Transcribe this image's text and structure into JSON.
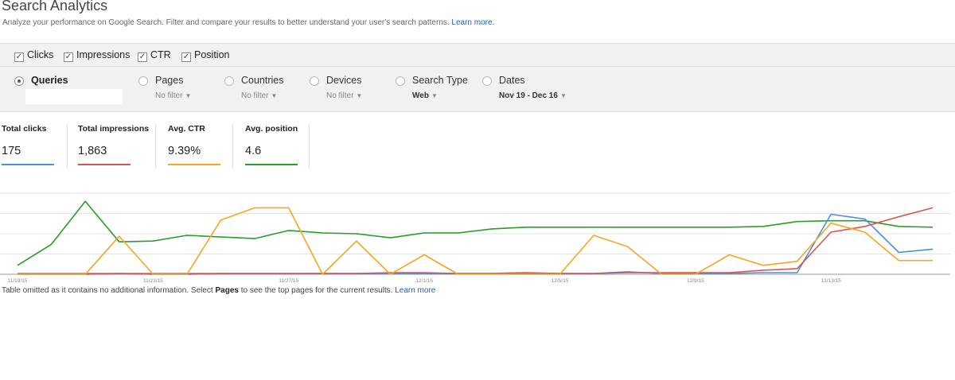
{
  "header": {
    "title": "Search Analytics",
    "subtitle": "Analyze your performance on Google Search. Filter and compare your results to better understand your user's search patterns.",
    "learn_more": "Learn more."
  },
  "metrics": {
    "clicks": {
      "label": "Clicks",
      "checked": true
    },
    "impressions": {
      "label": "Impressions",
      "checked": true
    },
    "ctr": {
      "label": "CTR",
      "checked": true
    },
    "position": {
      "label": "Position",
      "checked": true
    }
  },
  "group_by": {
    "queries": {
      "label": "Queries",
      "selected": true,
      "input_value": ""
    },
    "pages": {
      "label": "Pages",
      "filter": "No filter"
    },
    "countries": {
      "label": "Countries",
      "filter": "No filter"
    },
    "devices": {
      "label": "Devices",
      "filter": "No filter"
    },
    "search_type": {
      "label": "Search Type",
      "filter": "Web"
    },
    "dates": {
      "label": "Dates",
      "filter": "Nov 19 - Dec 16"
    }
  },
  "totals": {
    "clicks": {
      "label": "Total clicks",
      "value": "175",
      "color": "#4a90d9"
    },
    "impressions": {
      "label": "Total impressions",
      "value": "1,863",
      "color": "#d9534f"
    },
    "ctr": {
      "label": "Avg. CTR",
      "value": "9.39%",
      "color": "#f5a623"
    },
    "position": {
      "label": "Avg. position",
      "value": "4.6",
      "color": "#2a9d2a"
    }
  },
  "chart_data": {
    "type": "line",
    "x": [
      "11/19/15",
      "11/20/15",
      "11/21/15",
      "11/22/15",
      "11/23/15",
      "11/24/15",
      "11/25/15",
      "11/26/15",
      "11/27/15",
      "11/28/15",
      "11/29/15",
      "11/30/15",
      "12/1/15",
      "12/2/15",
      "12/3/15",
      "12/4/15",
      "12/5/15",
      "12/6/15",
      "12/7/15",
      "12/8/15",
      "12/9/15",
      "12/10/15",
      "12/11/15",
      "12/12/15",
      "12/13/15",
      "12/14/15",
      "12/15/15",
      "12/16/15"
    ],
    "tick_labels": [
      "11/19/15",
      "11/23/15",
      "11/27/15",
      "12/1/15",
      "12/5/15",
      "12/9/15",
      "12/13/15"
    ],
    "grid": true,
    "series": [
      {
        "name": "Clicks",
        "color": "#2a9d2a",
        "values": [
          0.11,
          0.37,
          0.9,
          0.4,
          0.41,
          0.48,
          0.46,
          0.44,
          0.54,
          0.51,
          0.5,
          0.45,
          0.51,
          0.51,
          0.56,
          0.58,
          0.58,
          0.58,
          0.58,
          0.58,
          0.58,
          0.58,
          0.59,
          0.65,
          0.66,
          0.66,
          0.59,
          0.58
        ]
      },
      {
        "name": "Impressions",
        "color": "#4a90d9",
        "values": [
          0.01,
          0.01,
          0.01,
          0.01,
          0.01,
          0.01,
          0.01,
          0.01,
          0.01,
          0.01,
          0.01,
          0.01,
          0.01,
          0.01,
          0.01,
          0.01,
          0.01,
          0.01,
          0.03,
          0.01,
          0.01,
          0.01,
          0.02,
          0.02,
          0.74,
          0.68,
          0.27,
          0.31
        ]
      },
      {
        "name": "CTR",
        "color": "#d9534f",
        "values": [
          0.0,
          0.0,
          0.0,
          0.01,
          0.0,
          0.0,
          0.01,
          0.01,
          0.01,
          0.01,
          0.01,
          0.02,
          0.02,
          0.01,
          0.01,
          0.02,
          0.01,
          0.01,
          0.02,
          0.02,
          0.02,
          0.02,
          0.05,
          0.07,
          0.52,
          0.59,
          0.71,
          0.82
        ]
      },
      {
        "name": "Position",
        "color": "#f5a623",
        "values": [
          0.0,
          0.0,
          0.0,
          0.47,
          0.0,
          0.0,
          0.67,
          0.82,
          0.82,
          0.0,
          0.41,
          0.0,
          0.24,
          0.0,
          0.0,
          0.0,
          0.0,
          0.48,
          0.34,
          0.0,
          0.0,
          0.24,
          0.11,
          0.16,
          0.63,
          0.52,
          0.17,
          0.17
        ]
      }
    ]
  },
  "footer": {
    "text_before": "Table omitted as it contains no additional information. Select",
    "bold": "Pages",
    "text_after": "to see the top pages for the current results.",
    "learn_more": "Learn more"
  }
}
